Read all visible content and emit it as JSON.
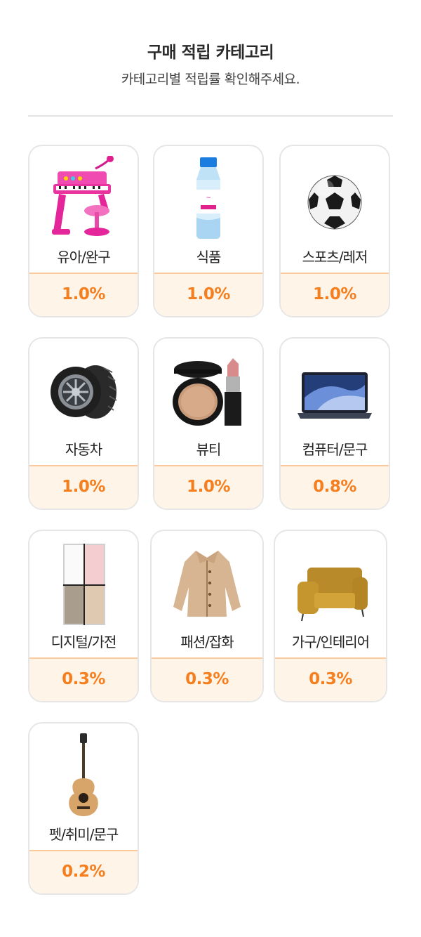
{
  "header": {
    "title": "구매 적립 카테고리",
    "subtitle": "카테고리별 적립률 확인해주세요."
  },
  "colors": {
    "accent": "#f57f1f",
    "rate_bg": "#fff4e8",
    "rate_border": "#fbc99a"
  },
  "categories": [
    {
      "label": "유아/완구",
      "rate": "1.0%",
      "icon": "toy-piano-icon"
    },
    {
      "label": "식품",
      "rate": "1.0%",
      "icon": "water-bottle-icon"
    },
    {
      "label": "스포츠/레저",
      "rate": "1.0%",
      "icon": "soccer-ball-icon"
    },
    {
      "label": "자동차",
      "rate": "1.0%",
      "icon": "tire-icon"
    },
    {
      "label": "뷰티",
      "rate": "1.0%",
      "icon": "cosmetics-icon"
    },
    {
      "label": "컴퓨터/문구",
      "rate": "0.8%",
      "icon": "laptop-icon"
    },
    {
      "label": "디지털/가전",
      "rate": "0.3%",
      "icon": "refrigerator-icon"
    },
    {
      "label": "패션/잡화",
      "rate": "0.3%",
      "icon": "jacket-icon"
    },
    {
      "label": "가구/인테리어",
      "rate": "0.3%",
      "icon": "sofa-icon"
    },
    {
      "label": "펫/취미/문구",
      "rate": "0.2%",
      "icon": "guitar-icon"
    }
  ]
}
